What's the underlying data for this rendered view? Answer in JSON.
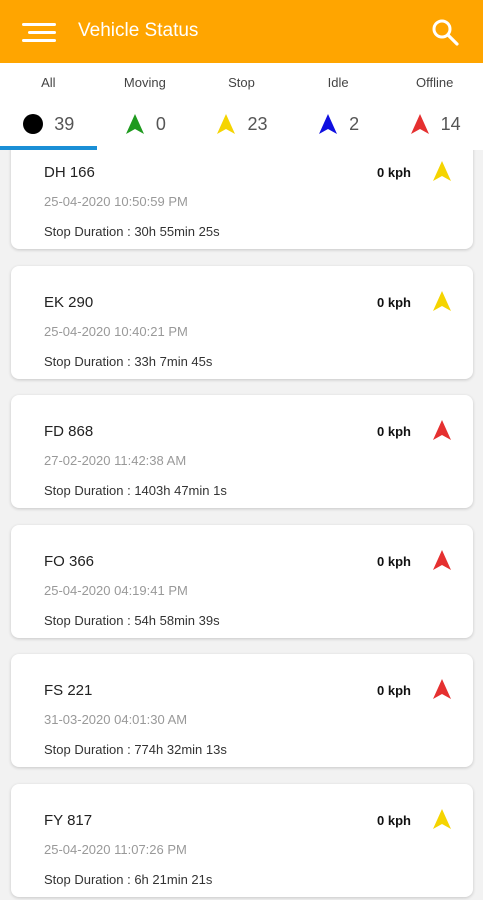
{
  "appbar": {
    "title": "Vehicle Status",
    "color": "#FFA500"
  },
  "tabs": [
    {
      "label": "All",
      "count": "39",
      "marker": "black-dot",
      "color": "#000000"
    },
    {
      "label": "Moving",
      "count": "0",
      "marker": "arrow",
      "color": "#1f9a1f"
    },
    {
      "label": "Stop",
      "count": "23",
      "marker": "arrow",
      "color": "#f5d400"
    },
    {
      "label": "Idle",
      "count": "2",
      "marker": "arrow",
      "color": "#1010e0"
    },
    {
      "label": "Offline",
      "count": "14",
      "marker": "arrow",
      "color": "#e53030"
    }
  ],
  "active_tab": "All",
  "vehicles": [
    {
      "plate": "DH 166",
      "speed": "0 kph",
      "timestamp": "25-04-2020 10:50:59 PM",
      "duration": "Stop Duration : 30h 55min 25s",
      "status": "stop",
      "color": "#f5d400"
    },
    {
      "plate": "EK 290",
      "speed": "0 kph",
      "timestamp": "25-04-2020 10:40:21 PM",
      "duration": "Stop Duration : 33h 7min 45s",
      "status": "stop",
      "color": "#f5d400"
    },
    {
      "plate": "FD 868",
      "speed": "0 kph",
      "timestamp": "27-02-2020 11:42:38 AM",
      "duration": "Stop Duration : 1403h 47min 1s",
      "status": "offline",
      "color": "#e53030"
    },
    {
      "plate": "FO 366",
      "speed": "0 kph",
      "timestamp": "25-04-2020 04:19:41 PM",
      "duration": "Stop Duration : 54h 58min 39s",
      "status": "offline",
      "color": "#e53030"
    },
    {
      "plate": "FS 221",
      "speed": "0 kph",
      "timestamp": "31-03-2020 04:01:30 AM",
      "duration": "Stop Duration : 774h 32min 13s",
      "status": "offline",
      "color": "#e53030"
    },
    {
      "plate": "FY 817",
      "speed": "0 kph",
      "timestamp": "25-04-2020 11:07:26 PM",
      "duration": "Stop Duration : 6h 21min 21s",
      "status": "stop",
      "color": "#f5d400"
    }
  ]
}
